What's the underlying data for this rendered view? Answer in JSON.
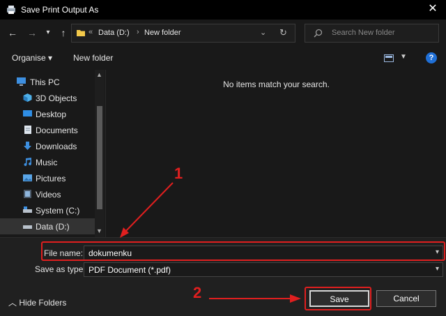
{
  "window": {
    "title": "Save Print Output As",
    "close_glyph": "✕"
  },
  "address": {
    "prefix": "«",
    "crumbs": [
      "Data (D:)",
      "New folder"
    ],
    "separator": "›",
    "search_placeholder": "Search New folder"
  },
  "toolbar": {
    "organise_label": "Organise ▾",
    "new_folder_label": "New folder",
    "help_glyph": "?"
  },
  "nav": {
    "items": [
      {
        "label": "This PC",
        "icon": "this-pc-icon"
      },
      {
        "label": "3D Objects",
        "icon": "3d-objects-icon"
      },
      {
        "label": "Desktop",
        "icon": "desktop-icon"
      },
      {
        "label": "Documents",
        "icon": "documents-icon"
      },
      {
        "label": "Downloads",
        "icon": "downloads-icon"
      },
      {
        "label": "Music",
        "icon": "music-icon"
      },
      {
        "label": "Pictures",
        "icon": "pictures-icon"
      },
      {
        "label": "Videos",
        "icon": "videos-icon"
      },
      {
        "label": "System (C:)",
        "icon": "drive-icon"
      },
      {
        "label": "Data (D:)",
        "icon": "drive-icon"
      }
    ]
  },
  "content": {
    "empty_message": "No items match your search."
  },
  "form": {
    "file_name_label": "File name:",
    "file_name_value": "dokumenku",
    "save_type_label": "Save as type:",
    "save_type_value": "PDF Document (*.pdf)",
    "hide_folders_label": "Hide Folders",
    "save_label": "Save",
    "cancel_label": "Cancel"
  },
  "annotations": {
    "marker_1": "1",
    "marker_2": "2",
    "color": "#e01f1f"
  },
  "colors": {
    "background": "#191919",
    "accent": "#1f6fd6",
    "folder": "#f3c94a"
  }
}
